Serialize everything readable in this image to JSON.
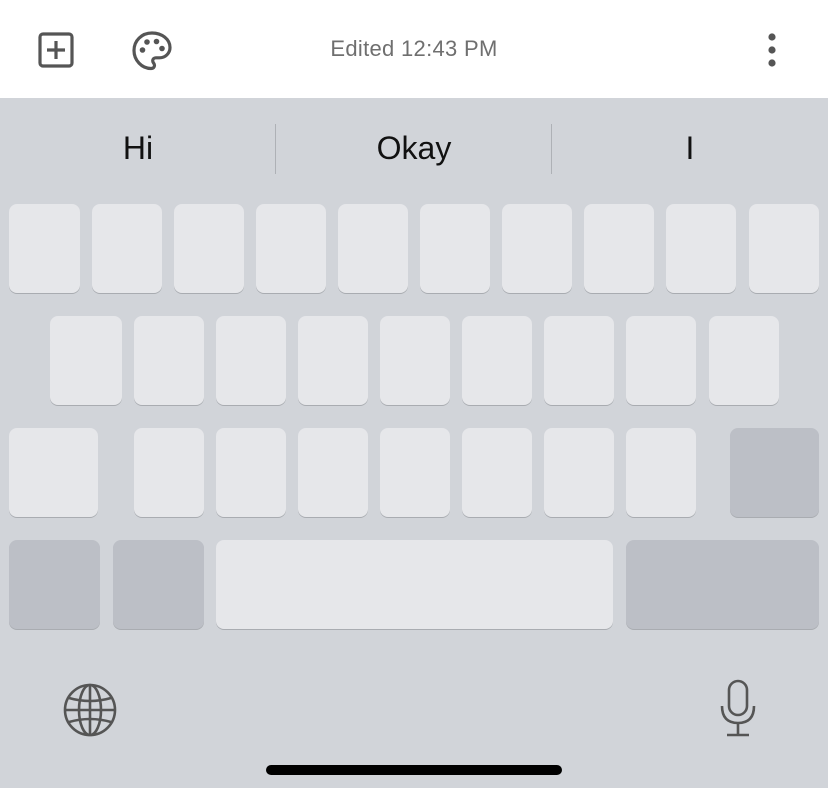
{
  "toolbar": {
    "add_icon": "plus-square-icon",
    "palette_icon": "palette-icon",
    "edited_text": "Edited 12:43 PM",
    "more_icon": "vertical-ellipsis-icon"
  },
  "keyboard": {
    "suggestions": [
      "Hi",
      "Okay",
      "I"
    ],
    "globe_icon": "globe-icon",
    "mic_icon": "microphone-icon"
  },
  "colors": {
    "toolbar_bg": "#ffffff",
    "keyboard_bg": "#d1d4d9",
    "key_light": "#e6e7ea",
    "key_dark": "#bcbfc6",
    "icon": "#555555",
    "home_indicator": "#000000"
  }
}
